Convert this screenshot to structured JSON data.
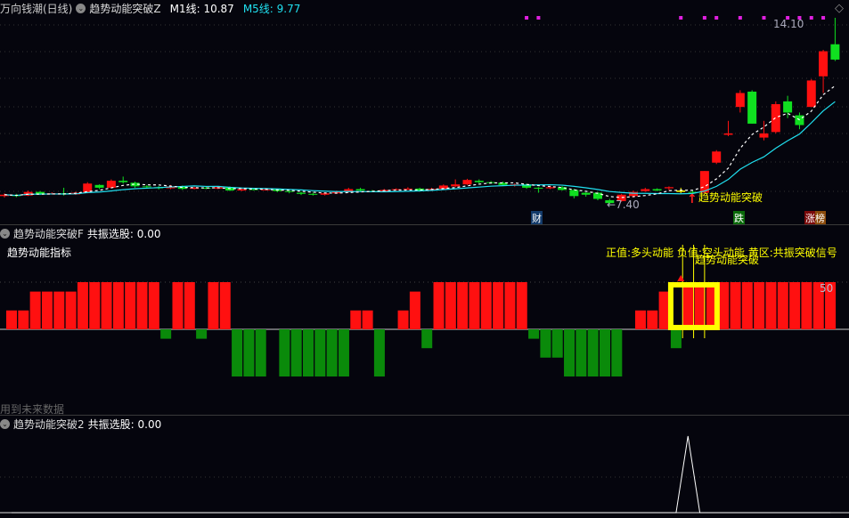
{
  "main_header": {
    "stock": "万向钱潮(日线)",
    "indicator": "趋势动能突破Z",
    "m1_label": "M1线: 10.87",
    "m5_label": "M5线: 9.77"
  },
  "price_labels": {
    "high": "14.10",
    "low": "←7.40"
  },
  "signal_label": "趋势动能突破",
  "badges": {
    "cai": "财",
    "die": "跌",
    "zhangbang": "涨榜"
  },
  "panel2": {
    "header": "趋势动能突破F",
    "resonance": "共振选股: 0.00",
    "title": "趋势动能指标",
    "legend": "正值:多头动能  负值:空头动能  黄区:共振突破信号",
    "overlay_label": "趋势动能突破",
    "level_label": "50",
    "footer_note": "用到未来数据"
  },
  "panel3": {
    "header": "趋势动能突破2",
    "resonance": "共振选股: 0.00"
  },
  "colors": {
    "up": "#ff1010",
    "down": "#10e020",
    "bar_down": "#0a8a0a",
    "yellow": "#ffff00",
    "ma5": "#ffffff",
    "ma10": "#20e0f0",
    "signal_dot": "#e020e0"
  },
  "chart_data": {
    "type": "candlestick",
    "price_range": [
      7.4,
      14.1
    ],
    "candles": [
      [
        7.7,
        7.75,
        7.8,
        7.65
      ],
      [
        7.74,
        7.7,
        7.78,
        7.66
      ],
      [
        7.72,
        7.85,
        7.9,
        7.7
      ],
      [
        7.85,
        7.78,
        7.88,
        7.74
      ],
      [
        7.78,
        7.8,
        7.84,
        7.75
      ],
      [
        7.8,
        7.76,
        8.0,
        7.72
      ],
      [
        7.76,
        7.82,
        7.86,
        7.74
      ],
      [
        7.82,
        8.15,
        8.2,
        7.8
      ],
      [
        8.1,
        8.0,
        8.12,
        7.95
      ],
      [
        8.0,
        8.25,
        8.3,
        7.98
      ],
      [
        8.25,
        8.2,
        8.4,
        8.15
      ],
      [
        8.18,
        8.05,
        8.22,
        8.0
      ],
      [
        8.05,
        8.02,
        8.1,
        7.98
      ],
      [
        8.02,
        7.98,
        8.06,
        7.94
      ],
      [
        7.98,
        8.05,
        8.1,
        7.95
      ],
      [
        8.05,
        7.96,
        8.08,
        7.92
      ],
      [
        7.96,
        8.0,
        8.04,
        7.94
      ],
      [
        8.0,
        7.97,
        8.03,
        7.95
      ],
      [
        7.97,
        8.02,
        8.05,
        7.95
      ],
      [
        8.02,
        7.9,
        8.05,
        7.88
      ],
      [
        7.9,
        7.95,
        7.98,
        7.88
      ],
      [
        7.95,
        7.92,
        7.98,
        7.9
      ],
      [
        7.92,
        7.94,
        8.0,
        7.9
      ],
      [
        7.94,
        7.88,
        7.96,
        7.84
      ],
      [
        7.88,
        7.85,
        7.9,
        7.8
      ],
      [
        7.82,
        7.78,
        7.86,
        7.74
      ],
      [
        7.78,
        7.75,
        7.82,
        7.72
      ],
      [
        7.75,
        7.8,
        7.84,
        7.72
      ],
      [
        7.8,
        7.85,
        7.9,
        7.78
      ],
      [
        7.85,
        7.95,
        8.0,
        7.82
      ],
      [
        7.95,
        7.9,
        8.0,
        7.86
      ],
      [
        7.88,
        7.86,
        7.92,
        7.84
      ],
      [
        7.86,
        7.92,
        7.96,
        7.84
      ],
      [
        7.92,
        7.95,
        7.98,
        7.9
      ],
      [
        7.95,
        7.97,
        8.02,
        7.92
      ],
      [
        7.97,
        7.9,
        8.0,
        7.86
      ],
      [
        7.92,
        7.96,
        8.0,
        7.9
      ],
      [
        7.96,
        8.08,
        8.12,
        7.94
      ],
      [
        8.05,
        8.12,
        8.3,
        8.02
      ],
      [
        8.12,
        8.28,
        8.32,
        8.1
      ],
      [
        8.25,
        8.2,
        8.3,
        8.15
      ],
      [
        8.2,
        8.18,
        8.24,
        8.14
      ],
      [
        8.18,
        8.1,
        8.22,
        8.06
      ],
      [
        8.08,
        8.12,
        8.16,
        8.04
      ],
      [
        8.12,
        8.0,
        8.15,
        7.96
      ],
      [
        8.0,
        7.98,
        8.02,
        7.82
      ],
      [
        7.98,
        8.02,
        8.08,
        7.95
      ],
      [
        8.02,
        7.92,
        8.06,
        7.9
      ],
      [
        7.92,
        7.7,
        7.96,
        7.62
      ],
      [
        7.82,
        7.75,
        7.84,
        7.68
      ],
      [
        7.82,
        7.6,
        7.85,
        7.55
      ],
      [
        7.55,
        7.45,
        7.6,
        7.4
      ],
      [
        7.52,
        7.75,
        7.78,
        7.5
      ],
      [
        7.7,
        7.85,
        7.9,
        7.65
      ],
      [
        7.88,
        7.95,
        8.0,
        7.85
      ],
      [
        7.95,
        7.9,
        7.98,
        7.88
      ],
      [
        7.98,
        8.02,
        8.05,
        7.9
      ],
      [
        7.9,
        7.85,
        8.0,
        7.8
      ],
      [
        7.85,
        7.82,
        7.9,
        7.78
      ],
      [
        7.82,
        8.6,
        8.6,
        7.8
      ],
      [
        8.9,
        9.3,
        9.35,
        8.85
      ],
      [
        9.9,
        9.95,
        10.4,
        9.85
      ],
      [
        10.9,
        11.4,
        11.5,
        10.7
      ],
      [
        11.45,
        10.3,
        11.5,
        10.3
      ],
      [
        9.8,
        9.95,
        10.4,
        9.7
      ],
      [
        10.0,
        11.0,
        11.1,
        9.95
      ],
      [
        11.1,
        10.7,
        11.3,
        10.5
      ],
      [
        10.6,
        10.25,
        10.7,
        10.1
      ],
      [
        10.9,
        11.85,
        11.9,
        10.9
      ],
      [
        12.0,
        12.9,
        12.95,
        11.4
      ],
      [
        13.15,
        12.6,
        14.1,
        12.55
      ]
    ],
    "signal_dots": [
      44,
      45,
      57,
      59,
      60,
      62,
      64,
      66,
      67,
      68,
      69
    ],
    "signal_candle": 57,
    "momentum": [
      20,
      20,
      40,
      40,
      40,
      40,
      50,
      50,
      50,
      50,
      50,
      50,
      50,
      -10,
      50,
      50,
      -10,
      50,
      50,
      -50,
      -50,
      -50,
      0,
      -50,
      -50,
      -50,
      -50,
      -50,
      -50,
      20,
      20,
      -50,
      0,
      20,
      40,
      -20,
      50,
      50,
      50,
      50,
      50,
      50,
      50,
      50,
      -10,
      -30,
      -30,
      -50,
      -50,
      -50,
      -50,
      -50,
      0,
      20,
      20,
      40,
      -20,
      50,
      50,
      50,
      50,
      50,
      50,
      50,
      50,
      50,
      50,
      50,
      50,
      50
    ],
    "yellow_zone": [
      56,
      59
    ],
    "resonance": [
      0,
      0,
      0,
      0,
      0,
      0,
      0,
      0,
      0,
      0,
      0,
      0,
      0,
      0,
      0,
      0,
      0,
      0,
      0,
      0,
      0,
      0,
      0,
      0,
      0,
      0,
      0,
      0,
      0,
      0,
      0,
      0,
      0,
      0,
      0,
      0,
      0,
      0,
      0,
      0,
      0,
      0,
      0,
      0,
      0,
      0,
      0,
      0,
      0,
      0,
      0,
      0,
      0,
      0,
      0,
      0,
      0,
      1,
      0,
      0,
      0,
      0,
      0,
      0,
      0,
      0,
      0,
      0,
      0,
      0
    ]
  }
}
